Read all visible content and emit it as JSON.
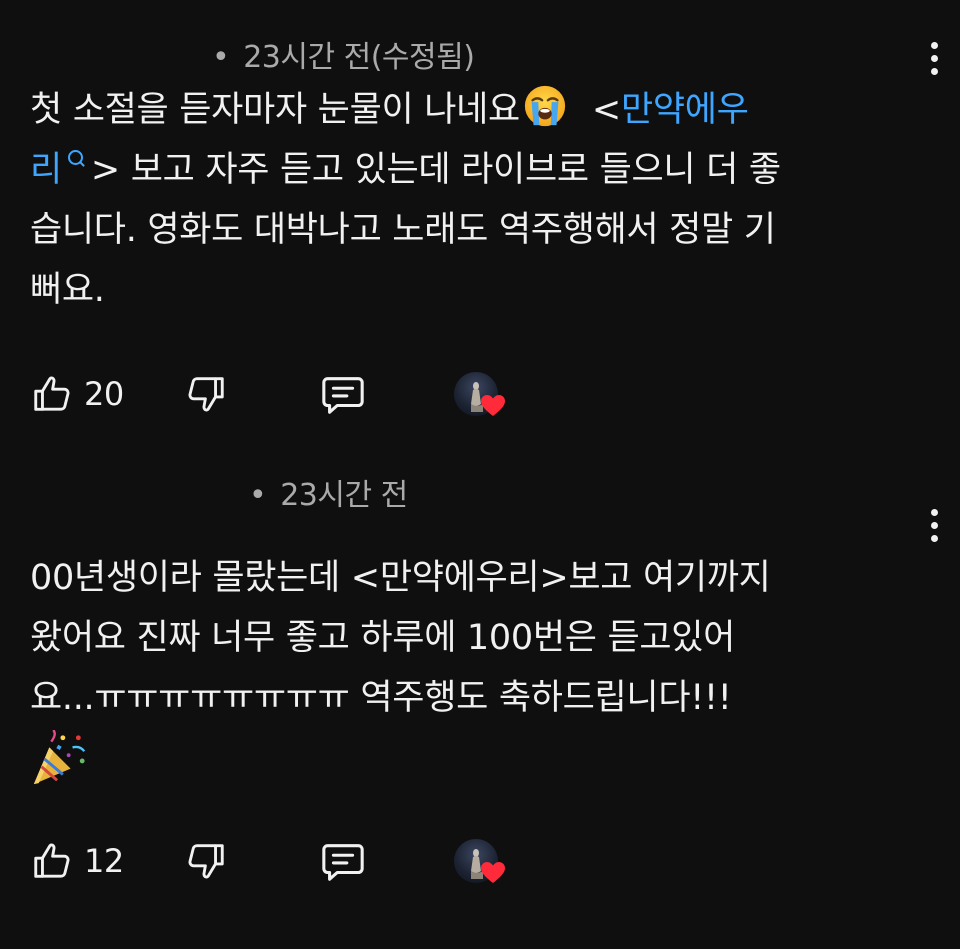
{
  "comments": [
    {
      "meta": "23시간 전(수정됨)",
      "text": {
        "line1_a": "첫 소절을 듣자마자 눈물이 나네요",
        "line1_b": "<",
        "line1_link": "만약에우",
        "line2_link": "리",
        "line2_rest": "> 보고 자주 듣고 있는데 라이브로 들으니 더 좋",
        "line3": "습니다.  영화도 대박나고 노래도 역주행해서 정말 기",
        "line4": "뻐요."
      },
      "likes": "20",
      "icons": {
        "like": "thumbs-up-icon",
        "dislike": "thumbs-down-icon",
        "reply": "reply-icon",
        "creator_heart": "creator-heart-icon",
        "more": "more-vert-icon",
        "emoji": "loudly-crying-face-emoji"
      }
    },
    {
      "meta": "23시간 전",
      "text": {
        "line1": "00년생이라 몰랐는데 <만약에우리>보고 여기까지",
        "line2": "왔어요 진짜 너무 좋고 하루에 100번은 듣고있어",
        "line3": "요...ㅠㅠㅠㅠㅠㅠㅠㅠ 역주행도 축하드립니다!!!"
      },
      "likes": "12",
      "icons": {
        "like": "thumbs-up-icon",
        "dislike": "thumbs-down-icon",
        "reply": "reply-icon",
        "creator_heart": "creator-heart-icon",
        "more": "more-vert-icon",
        "emoji": "party-popper-emoji"
      }
    }
  ],
  "colors": {
    "background": "#0f0f0f",
    "text": "#f1f1f1",
    "meta": "#aaaaaa",
    "link": "#3ea6ff",
    "heart": "#ff2a3a"
  }
}
